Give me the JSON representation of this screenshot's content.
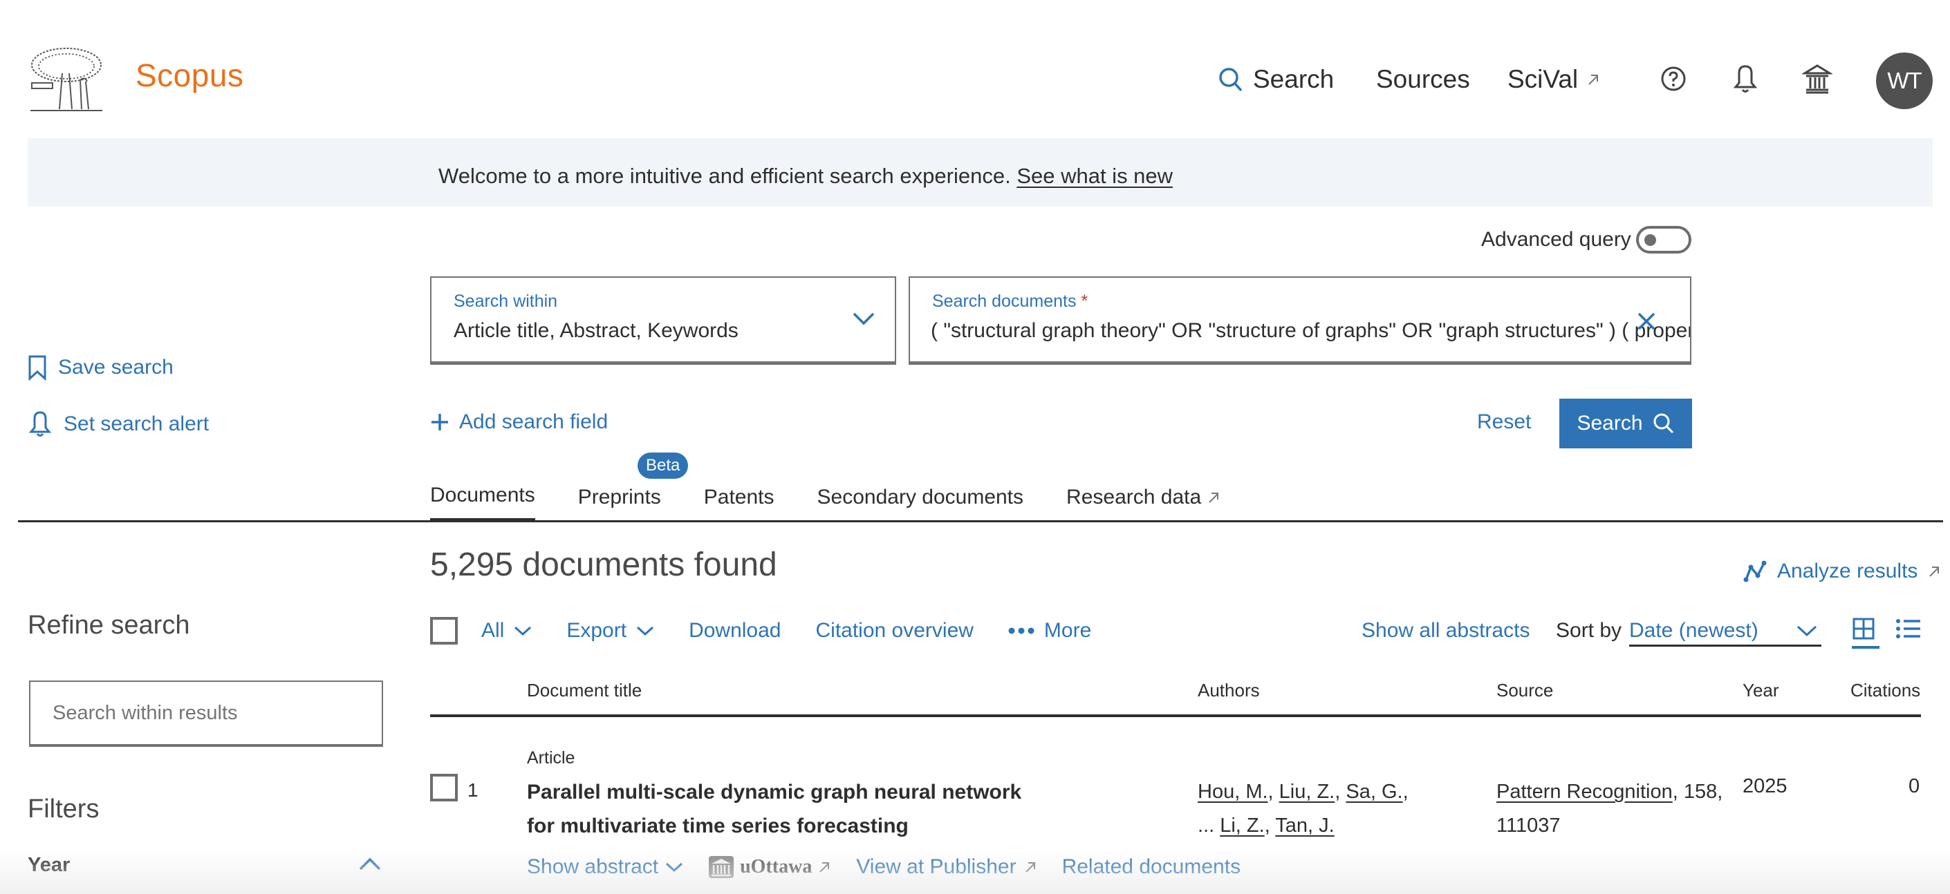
{
  "header": {
    "brand": "Scopus",
    "nav": {
      "search": "Search",
      "sources": "Sources",
      "scival": "SciVal"
    },
    "avatar_initials": "WT",
    "icons": [
      "help-icon",
      "bell-icon",
      "institution-icon"
    ]
  },
  "banner": {
    "text": "Welcome to a more intuitive and efficient search experience.",
    "link": "See what is new"
  },
  "search": {
    "advanced_query_label": "Advanced query",
    "advanced_query_on": false,
    "within_label": "Search within",
    "within_value": "Article title, Abstract, Keywords",
    "query_label": "Search documents",
    "query_required_mark": "*",
    "query_value": "( \"structural graph theory\" OR \"structure of graphs\" OR \"graph structures\" ) ( properti",
    "add_field": "Add search field",
    "reset": "Reset",
    "search_button": "Search"
  },
  "sidebar": {
    "save_search": "Save search",
    "set_alert": "Set search alert",
    "refine_title": "Refine search",
    "refine_placeholder": "Search within results",
    "filters_title": "Filters",
    "year_filter": "Year"
  },
  "tabs": [
    {
      "label": "Documents",
      "active": true
    },
    {
      "label": "Preprints",
      "badge": "Beta"
    },
    {
      "label": "Patents"
    },
    {
      "label": "Secondary documents"
    },
    {
      "label": "Research data",
      "external": true
    }
  ],
  "results": {
    "count_text": "5,295 documents found",
    "analyze": "Analyze results",
    "toolbar": {
      "all": "All",
      "export": "Export",
      "download": "Download",
      "citation_overview": "Citation overview",
      "more": "More",
      "show_all_abstracts": "Show all abstracts",
      "sort_by_label": "Sort by",
      "sort_value": "Date (newest)"
    },
    "columns": [
      "Document title",
      "Authors",
      "Source",
      "Year",
      "Citations"
    ],
    "rows": [
      {
        "index": "1",
        "type": "Article",
        "title": "Parallel multi-scale dynamic graph neural network for multivariate time series forecasting",
        "authors_line1": [
          "Hou, M.",
          "Liu, Z.",
          "Sa, G."
        ],
        "authors_ellipsis": "...",
        "authors_line2": [
          "Li, Z.",
          "Tan, J."
        ],
        "source_name": "Pattern Recognition",
        "source_detail": ", 158, 111037",
        "year": "2025",
        "citations": "0",
        "actions": {
          "show_abstract": "Show abstract",
          "institution_link": "uOttawa",
          "view_publisher": "View at Publisher",
          "related": "Related documents"
        }
      }
    ]
  },
  "colors": {
    "accent": "#2e73b5",
    "brand": "#e9711c",
    "banner_bg": "#f1f5f9",
    "avatar_bg": "#505050"
  }
}
